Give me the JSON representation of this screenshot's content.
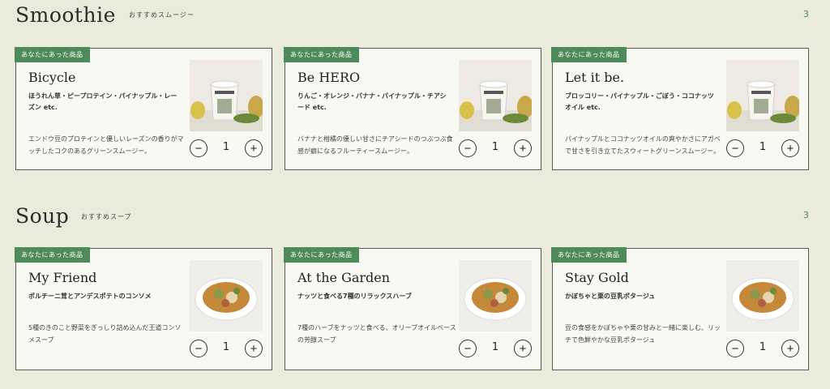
{
  "smoothie": {
    "title": "Smoothie",
    "subtitle": "おすすめスムージー",
    "count": "3",
    "cards": [
      {
        "badge": "あなたにあった商品",
        "name": "Bicycle",
        "ingredients": "ほうれん草・ピープロテイン・パイナップル・レーズン etc.",
        "description": "エンドウ豆のプロテインと優しいレーズンの香りがマッチしたコクのあるグリーンスムージー。",
        "quantity": "1"
      },
      {
        "badge": "あなたにあった商品",
        "name": "Be HERO",
        "ingredients": "りんご・オレンジ・バナナ・パイナップル・チアシード etc.",
        "description": "バナナと柑橘の優しい甘さにチアシードのつぶつぶ食感が癖になるフルーティースムージー。",
        "quantity": "1"
      },
      {
        "badge": "あなたにあった商品",
        "name": "Let it be.",
        "ingredients": "ブロッコリー・パイナップル・ごぼう・ココナッツオイル etc.",
        "description": "パイナップルとココナッツオイルの爽やかさにアガベで甘さを引き立てたスウィートグリーンスムージー。",
        "quantity": "1"
      }
    ]
  },
  "soup": {
    "title": "Soup",
    "subtitle": "おすすめスープ",
    "count": "3",
    "cards": [
      {
        "badge": "あなたにあった商品",
        "name": "My Friend",
        "ingredients": "ポルチーニ茸とアンデスポテトのコンソメ",
        "description": "5種のきのこと野菜をぎっしり詰め込んだ王道コンソメスープ",
        "quantity": "1"
      },
      {
        "badge": "あなたにあった商品",
        "name": "At the Garden",
        "ingredients": "ナッツと食べる7種のリラックスハーブ",
        "description": "7種のハーブをナッツと食べる、オリーブオイルベースの芳醇スープ",
        "quantity": "1"
      },
      {
        "badge": "あなたにあった商品",
        "name": "Stay Gold",
        "ingredients": "かぼちゃと栗の豆乳ポタージュ",
        "description": "豆の食感をかぼちゃや栗の甘みと一緒に楽しむ、リッチで色鮮やかな豆乳ポタージュ",
        "quantity": "1"
      }
    ]
  },
  "colors": {
    "accent": "#4f8a5a",
    "background": "#ebebdc",
    "card": "#f9f9f4"
  },
  "icons": {
    "minus": "minus-icon",
    "plus": "plus-icon"
  }
}
